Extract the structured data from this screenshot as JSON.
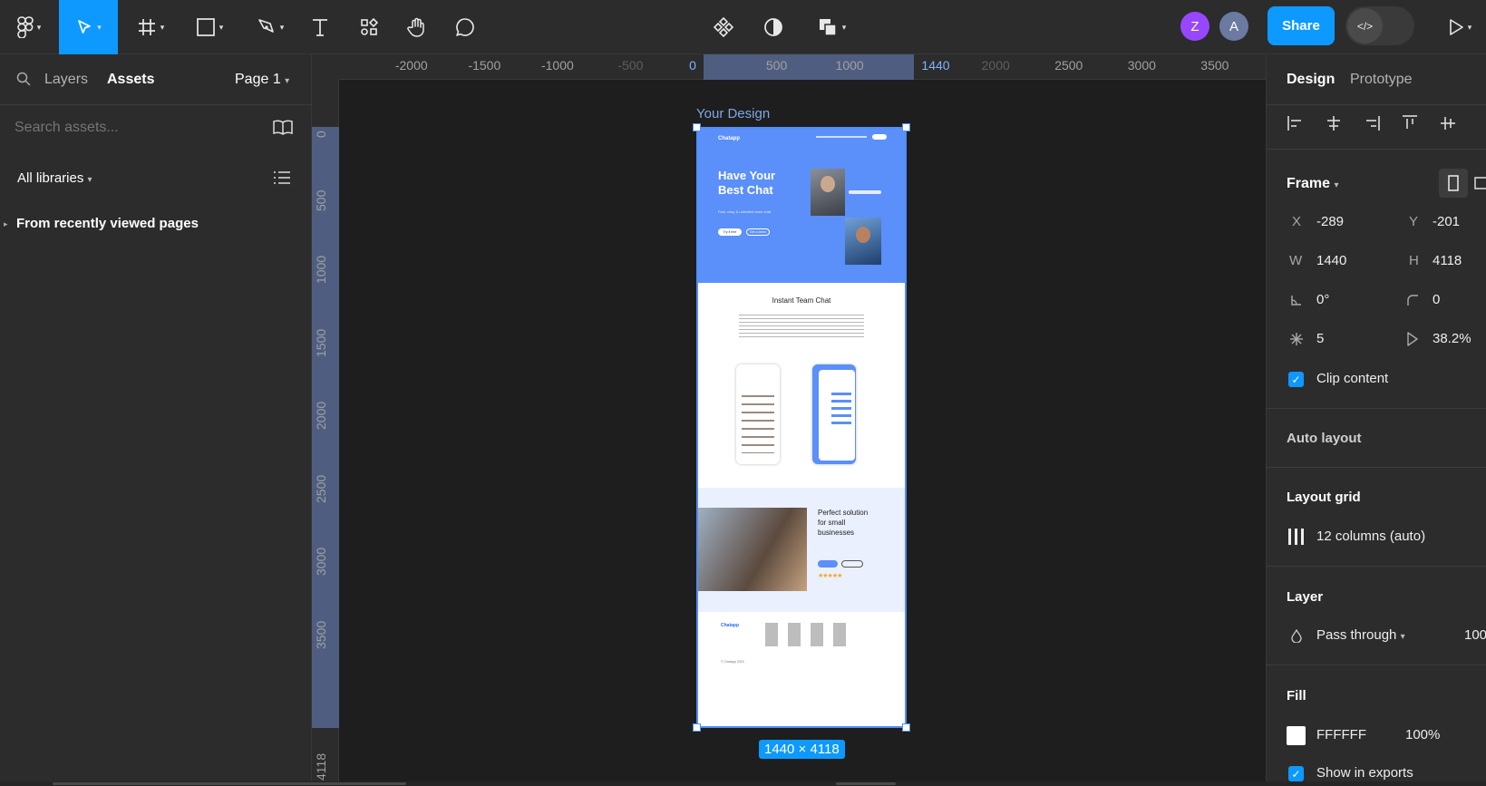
{
  "toolbar": {
    "avatars": [
      "Z",
      "A"
    ],
    "share_label": "Share",
    "dev_mode_icon": "</>"
  },
  "left_panel": {
    "tab_layers": "Layers",
    "tab_assets": "Assets",
    "page_selector": "Page 1",
    "search_placeholder": "Search assets...",
    "libraries_label": "All libraries",
    "recent_section": "From recently viewed pages"
  },
  "canvas": {
    "h_ruler_labels": [
      "-2000",
      "-1500",
      "-1000",
      "-500",
      "0",
      "500",
      "1000",
      "1440",
      "2000",
      "2500",
      "3000",
      "3500"
    ],
    "v_ruler_labels": [
      "0",
      "500",
      "1000",
      "1500",
      "2000",
      "2500",
      "3000",
      "3500",
      "4118"
    ],
    "frame_name": "Your Design",
    "frame_size_badge": "1440 × 4118"
  },
  "design_frame": {
    "logo": "Chatapp",
    "hero_title_1": "Have Your",
    "hero_title_2": "Best Chat",
    "hero_sub": "Fast, easy & unlimited team chat",
    "btn_try": "Try it free",
    "btn_demo": "Get a demo",
    "section2_title": "Instant Team Chat",
    "section3_title_1": "Perfect solution",
    "section3_title_2": "for small",
    "section3_title_3": "businesses",
    "stars": "★★★★★",
    "footer_copyright": "© Chatapp 2023"
  },
  "right_panel": {
    "tab_design": "Design",
    "tab_prototype": "Prototype",
    "frame_section": "Frame",
    "x_label": "X",
    "x_value": "-289",
    "y_label": "Y",
    "y_value": "-201",
    "w_label": "W",
    "w_value": "1440",
    "h_label": "H",
    "h_value": "4118",
    "rotation_value": "0°",
    "radius_value": "0",
    "count_value": "5",
    "ratio_value": "38.2%",
    "clip_content_label": "Clip content",
    "auto_layout_section": "Auto layout",
    "layout_grid_section": "Layout grid",
    "layout_grid_value": "12 columns (auto)",
    "layer_section": "Layer",
    "blend_mode": "Pass through",
    "opacity_value": "100",
    "fill_section": "Fill",
    "fill_hex": "FFFFFF",
    "fill_opacity": "100%",
    "show_exports_label": "Show in exports"
  },
  "colors": {
    "accent": "#0d99ff",
    "frame_blue": "#5b8ff9",
    "avatar_z": "#9747ff",
    "avatar_a": "#6b7aa0"
  }
}
